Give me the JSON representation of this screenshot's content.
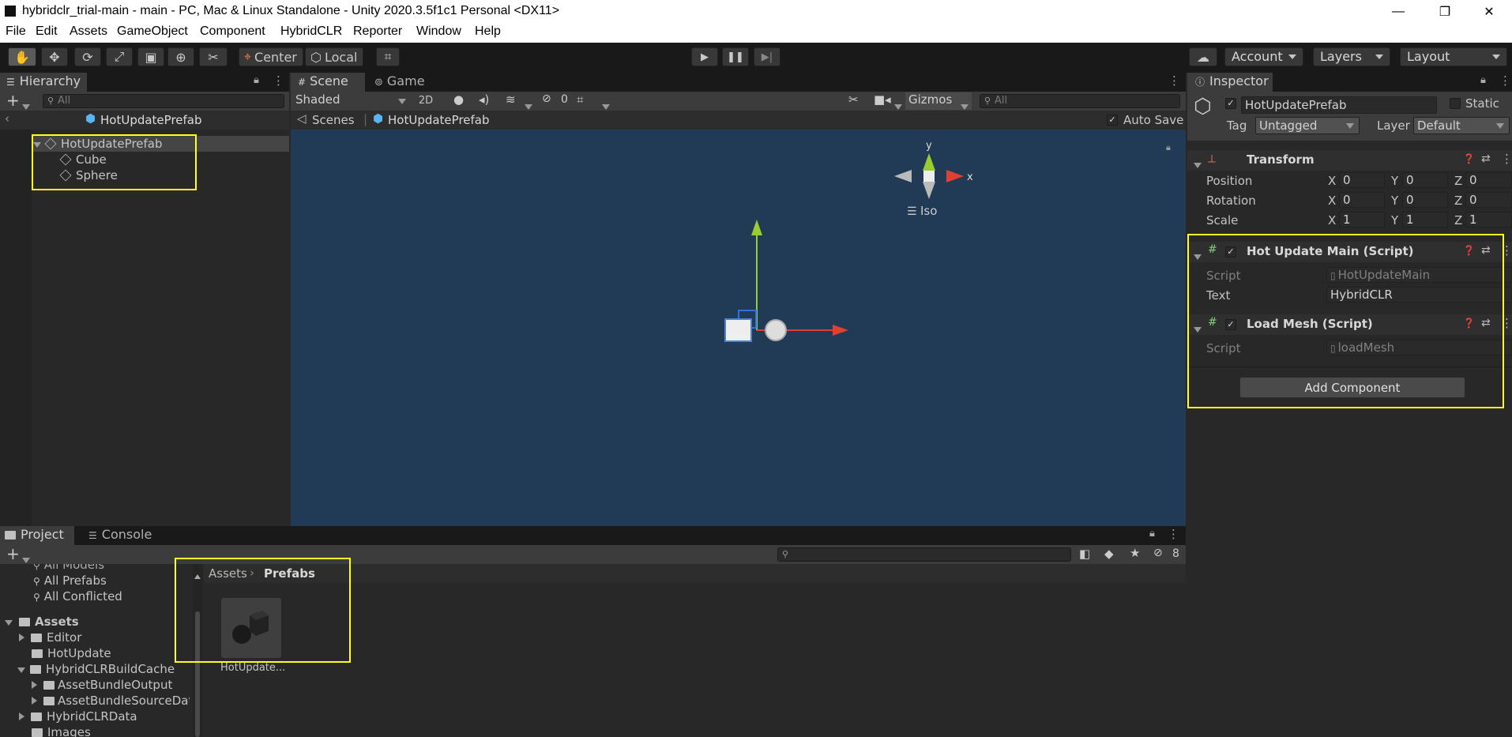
{
  "window": {
    "title": "hybridclr_trial-main - main - PC, Mac & Linux Standalone - Unity 2020.3.5f1c1 Personal <DX11>",
    "controls": [
      "—",
      "❐",
      "✕"
    ]
  },
  "menu": [
    "File",
    "Edit",
    "Assets",
    "GameObject",
    "Component",
    "HybridCLR",
    "Reporter",
    "Window",
    "Help"
  ],
  "toolbar": {
    "pivot": "Center",
    "space": "Local",
    "account": "Account",
    "layers": "Layers",
    "layout": "Layout"
  },
  "hierarchy": {
    "tab": "Hierarchy",
    "search_placeholder": "All",
    "prefab_header": "HotUpdatePrefab",
    "items": [
      {
        "label": "HotUpdatePrefab"
      },
      {
        "label": "Cube"
      },
      {
        "label": "Sphere"
      }
    ]
  },
  "scene": {
    "tab_scene": "Scene",
    "tab_game": "Game",
    "shading": "Shaded",
    "mode_2d": "2D",
    "hidden_count": "0",
    "gizmos": "Gizmos",
    "search_placeholder": "All",
    "breadcrumb_root": "Scenes",
    "breadcrumb_prefab": "HotUpdatePrefab",
    "auto_save": "Auto Save",
    "gizmo_y": "y",
    "gizmo_x": "x",
    "iso": "Iso",
    "background": "#213a56"
  },
  "inspector": {
    "tab": "Inspector",
    "object_name": "HotUpdatePrefab",
    "static": "Static",
    "tag_label": "Tag",
    "tag_value": "Untagged",
    "layer_label": "Layer",
    "layer_value": "Default",
    "transform": {
      "title": "Transform",
      "position": {
        "label": "Position",
        "x": "0",
        "y": "0",
        "z": "0"
      },
      "rotation": {
        "label": "Rotation",
        "x": "0",
        "y": "0",
        "z": "0"
      },
      "scale": {
        "label": "Scale",
        "x": "1",
        "y": "1",
        "z": "1"
      },
      "axis_x": "X",
      "axis_y": "Y",
      "axis_z": "Z"
    },
    "hot_update_main": {
      "title": "Hot Update Main (Script)",
      "script_label": "Script",
      "script_value": "HotUpdateMain",
      "text_label": "Text",
      "text_value": "HybridCLR"
    },
    "load_mesh": {
      "title": "Load Mesh (Script)",
      "script_label": "Script",
      "script_value": "loadMesh"
    },
    "add_component": "Add Component"
  },
  "project": {
    "tab_project": "Project",
    "tab_console": "Console",
    "hidden_count": "8",
    "tree": [
      {
        "label": "All Models"
      },
      {
        "label": "All Prefabs"
      },
      {
        "label": "All Conflicted"
      },
      {
        "label": "Assets"
      },
      {
        "label": "Editor"
      },
      {
        "label": "HotUpdate"
      },
      {
        "label": "HybridCLRBuildCache"
      },
      {
        "label": "AssetBundleOutput"
      },
      {
        "label": "AssetBundleSourceData"
      },
      {
        "label": "HybridCLRData"
      },
      {
        "label": "Images"
      }
    ],
    "breadcrumb_root": "Assets",
    "breadcrumb_current": "Prefabs",
    "asset_label": "HotUpdate..."
  },
  "colors": {
    "highlight": "#ffff22",
    "panel": "#282828",
    "toolbar": "#191919"
  }
}
